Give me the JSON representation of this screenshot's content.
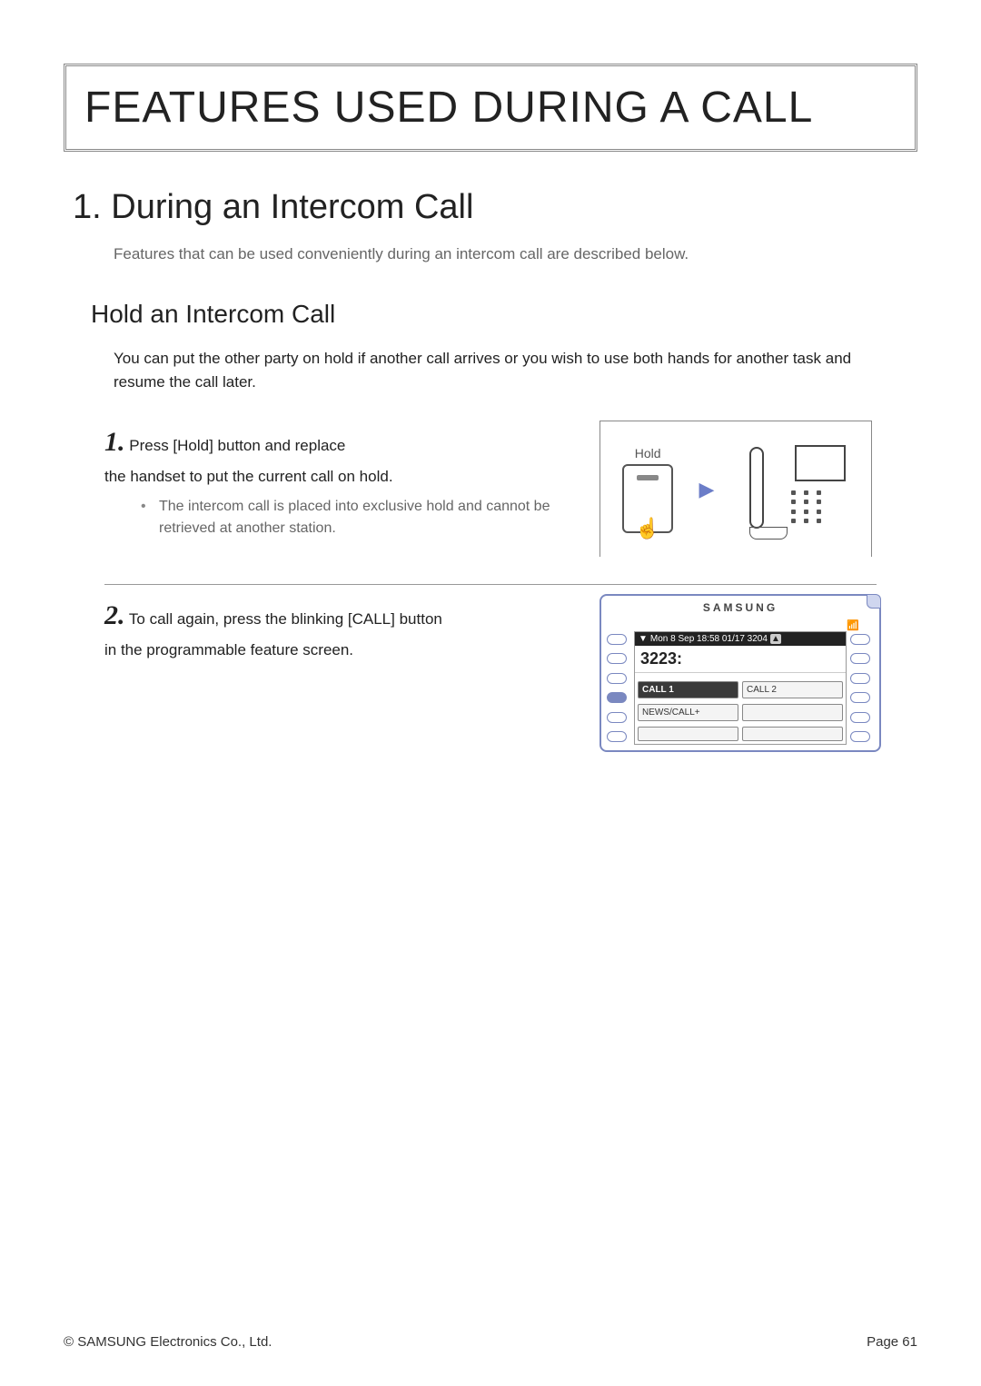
{
  "page": {
    "title": "FEATURES USED DURING A CALL"
  },
  "section": {
    "number_title": "1. During an Intercom Call",
    "intro": "Features that can be used conveniently during an intercom call are described below."
  },
  "subsection": {
    "title": "Hold an Intercom Call",
    "body": "You can put the other party on hold if another call arrives or you wish to use both hands for another task and resume the call later."
  },
  "steps": [
    {
      "num": "1.",
      "text_lead": "Press [Hold]  button and replace",
      "text_rest": "the handset to put the current call on hold.",
      "bullets": [
        "The intercom call is placed into exclusive hold and cannot be retrieved at another station."
      ]
    },
    {
      "num": "2.",
      "text_lead": "To call again, press the blinking [CALL]  button",
      "text_rest": "in the programmable feature screen.",
      "bullets": []
    }
  ],
  "illus1": {
    "hold_label": "Hold"
  },
  "screen": {
    "brand": "SAMSUNG",
    "status_line": "Mon 8 Sep  18:58  01/17      3204",
    "down_tri": "▼",
    "up_tri": "▲",
    "number": "3223:",
    "buttons_row1": [
      "CALL 1",
      "CALL 2"
    ],
    "buttons_row2": [
      "NEWS/CALL+",
      ""
    ]
  },
  "footer": {
    "copyright": "© SAMSUNG Electronics Co., Ltd.",
    "page": "Page 61"
  }
}
